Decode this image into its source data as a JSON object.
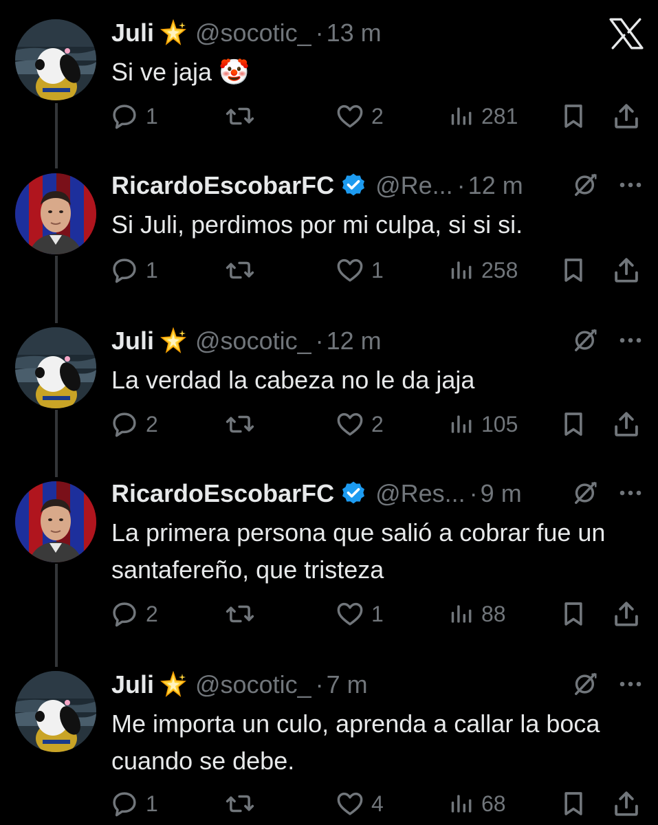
{
  "tweets": [
    {
      "name": "Juli",
      "badge": "sparkle-star",
      "handle": "@socotic_",
      "time": "13 m",
      "text": "Si ve jaja 🤡",
      "replies": "1",
      "retweets": "",
      "likes": "2",
      "views": "281"
    },
    {
      "name": "RicardoEscobarFC",
      "badge": "verified",
      "handle": "@Re...",
      "time": "12 m",
      "text": "Si Juli, perdimos por mi culpa, si si si.",
      "replies": "1",
      "retweets": "",
      "likes": "1",
      "views": "258"
    },
    {
      "name": "Juli",
      "badge": "sparkle-star",
      "handle": "@socotic_",
      "time": "12 m",
      "text": "La verdad la cabeza no le da jaja",
      "replies": "2",
      "retweets": "",
      "likes": "2",
      "views": "105"
    },
    {
      "name": "RicardoEscobarFC",
      "badge": "verified",
      "handle": "@Res...",
      "time": "9 m",
      "text": "La primera persona que salió a cobrar fue un santafereño, que tristeza",
      "replies": "2",
      "retweets": "",
      "likes": "1",
      "views": "88"
    },
    {
      "name": "Juli",
      "badge": "sparkle-star",
      "handle": "@socotic_",
      "time": "7 m",
      "text": "Me importa un culo, aprenda a callar la boca cuando se debe.",
      "replies": "1",
      "retweets": "",
      "likes": "4",
      "views": "68"
    }
  ],
  "colors": {
    "text": "#e7e9ea",
    "muted": "#71767b",
    "verified": "#1d9bf0",
    "background": "#000000"
  }
}
